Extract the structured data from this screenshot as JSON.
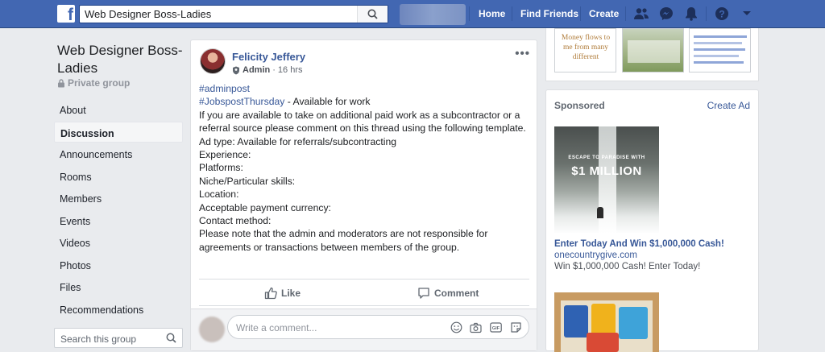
{
  "topbar": {
    "search_value": "Web Designer Boss-Ladies",
    "home": "Home",
    "find_friends": "Find Friends",
    "create": "Create",
    "brand_color": "#4267b2"
  },
  "group": {
    "name": "Web Designer Boss-Ladies",
    "privacy": "Private group",
    "menu": [
      "About",
      "Discussion",
      "Announcements",
      "Rooms",
      "Members",
      "Events",
      "Videos",
      "Photos",
      "Files",
      "Recommendations"
    ],
    "active_menu": "Discussion",
    "search_placeholder": "Search this group"
  },
  "post": {
    "author": "Felicity Jeffery",
    "role": "Admin",
    "time": "16 hrs",
    "hashtag1": "#adminpost",
    "hashtag2": "#JobspostThursday",
    "hashtag2_suffix": " - Available for work",
    "lines": [
      "If you are available to take on additional paid work as a subcontractor or a referral source please comment on this thread using the following template.",
      "Ad type: Available for referrals/subcontracting",
      "Experience:",
      "Platforms:",
      "Niche/Particular skills:",
      "Location:",
      "Acceptable payment currency:",
      "Contact method:",
      "Please note that the admin and moderators are not responsible for agreements or transactions between members of the group."
    ],
    "like": "Like",
    "comment": "Comment",
    "comment_placeholder": "Write a comment..."
  },
  "sidebar": {
    "thumb_text": "Money flows to me from many different",
    "sponsored": "Sponsored",
    "create_ad": "Create Ad",
    "ad1": {
      "image_subtext": "ESCAPE TO PARADISE WITH",
      "image_main": "$1 MILLION",
      "title": "Enter Today And Win $1,000,000 Cash!",
      "url": "onecountrygive.com",
      "desc": "Win $1,000,000 Cash! Enter Today!"
    }
  }
}
